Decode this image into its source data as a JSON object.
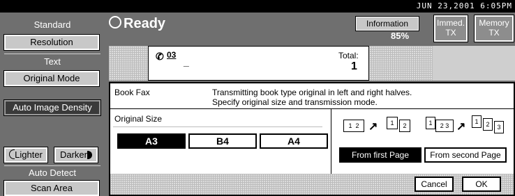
{
  "topbar": {
    "datetime": "JUN  23,2001  6:05PM"
  },
  "left": {
    "standard_label": "Standard",
    "resolution_btn": "Resolution",
    "text_label": "Text",
    "original_mode_btn": "Original Mode",
    "auto_image_density_btn": "Auto Image Density",
    "lighter_btn": "Lighter",
    "darker_btn": "Darker",
    "auto_detect_label": "Auto Detect",
    "scan_area_btn": "Scan Area"
  },
  "header": {
    "ready": "Ready",
    "information_btn": "Information",
    "memory_pct": "85%",
    "immed_tx_line1": "Immed.",
    "immed_tx_line2": "TX",
    "memory_tx_line1": "Memory",
    "memory_tx_line2": "TX"
  },
  "status": {
    "dest_count": "03",
    "dest_placeholder": "_",
    "total_label": "Total:",
    "total_value": "1"
  },
  "dialog": {
    "title": "Book Fax",
    "desc_line1": "Transmitting book type original in left and right halves.",
    "desc_line2": "Specify original size and transmission mode.",
    "original_size_label": "Original Size",
    "sizes": [
      "A3",
      "B4",
      "A4"
    ],
    "selected_size": "A3",
    "from_first_page": "From first Page",
    "from_second_page": "From second Page",
    "cancel": "Cancel",
    "ok": "OK"
  }
}
